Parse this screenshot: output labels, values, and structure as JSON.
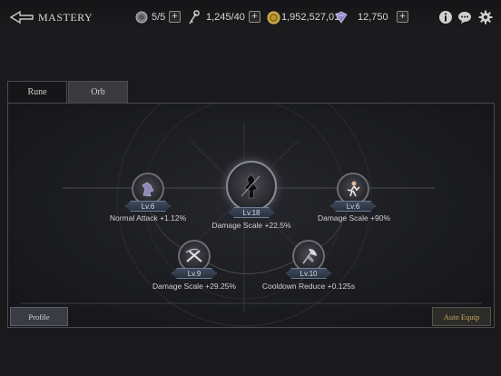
{
  "header": {
    "title": "MASTERY",
    "back_icon": "back-arrow-icon",
    "resources": [
      {
        "name": "stamina",
        "icon": "shield-token-icon",
        "value": "5/5"
      },
      {
        "name": "keys",
        "icon": "key-icon",
        "value": "1,245/40"
      },
      {
        "name": "gold",
        "icon": "gold-coin-icon",
        "value": "1,952,527,017"
      },
      {
        "name": "gems",
        "icon": "crystal-icon",
        "value": "12,750"
      }
    ],
    "tools": [
      "info-icon",
      "chat-icon",
      "settings-gear-icon"
    ]
  },
  "tabs": [
    {
      "label": "Rune",
      "active": false
    },
    {
      "label": "Orb",
      "active": true
    }
  ],
  "orbs": [
    {
      "id": "center",
      "level": "Lv.18",
      "effect": "Damage Scale +22.5%",
      "icon": "warrior-silhouette-icon"
    },
    {
      "id": "left",
      "level": "Lv.6",
      "effect": "Normal Attack +1.12%",
      "icon": "crouching-figure-icon"
    },
    {
      "id": "right",
      "level": "Lv.6",
      "effect": "Damage Scale +90%",
      "icon": "dancer-figure-icon"
    },
    {
      "id": "bottom-left",
      "level": "Lv.9",
      "effect": "Damage Scale +29.25%",
      "icon": "crossed-blades-icon"
    },
    {
      "id": "bottom-right",
      "level": "Lv.10",
      "effect": "Cooldown Reduce +0.125s",
      "icon": "axe-icon"
    }
  ],
  "buttons": {
    "profile": "Profile",
    "auto_equip": "Auto Equip"
  },
  "colors": {
    "accent_gold": "#c9a85e",
    "level_badge": "#283240",
    "background": "#1a1a1c"
  }
}
